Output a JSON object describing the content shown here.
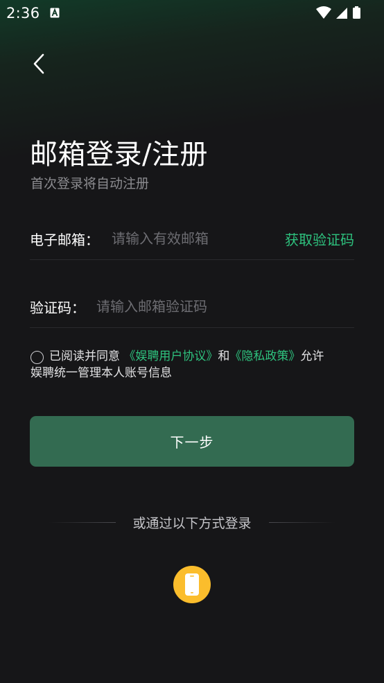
{
  "status_bar": {
    "time": "2:36",
    "notification_icon": "font-a-icon",
    "icons": [
      "wifi-icon",
      "signal-icon",
      "battery-icon"
    ]
  },
  "header": {
    "back_icon": "chevron-left-icon"
  },
  "main": {
    "title": "邮箱登录/注册",
    "subtitle": "首次登录将自动注册",
    "email_field": {
      "label": "电子邮箱：",
      "placeholder": "请输入有效邮箱",
      "value": "",
      "action_label": "获取验证码"
    },
    "code_field": {
      "label": "验证码：",
      "placeholder": "请输入邮箱验证码",
      "value": ""
    },
    "agreement": {
      "checked": false,
      "prefix": "已阅读并同意",
      "user_agreement": "《娱聘用户协议》",
      "conjunction": "和",
      "privacy_policy": "《隐私政策》",
      "suffix": "允许",
      "line2": "娱聘统一管理本人账号信息"
    },
    "next_button_label": "下一步",
    "alt_login": {
      "divider_text": "或通过以下方式登录",
      "phone_icon": "phone-icon"
    }
  },
  "colors": {
    "accent": "#2ec27e",
    "button": "#336b51",
    "background": "#161618",
    "phone_badge": "#fbbd2c"
  }
}
